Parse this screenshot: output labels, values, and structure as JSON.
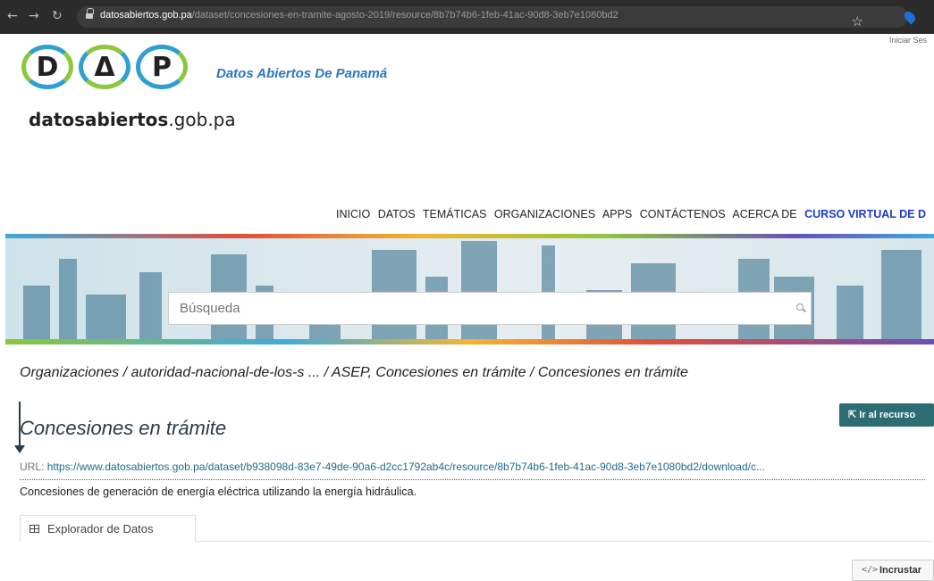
{
  "browser": {
    "url_host": "datosabiertos.gob.pa",
    "url_path": "/dataset/concesiones-en-tramite-agosto-2019/resource/8b7b74b6-1feb-41ac-90d8-3eb7e1080bd2",
    "back_icon": "back-arrow-icon",
    "forward_icon": "forward-arrow-icon",
    "reload_icon": "reload-icon",
    "star_icon": "bookmark-star-icon",
    "partial_text": "Iniciar Ses"
  },
  "logo": {
    "letters": [
      "D",
      "Δ",
      "P"
    ],
    "sub_bold": "datosabiertos",
    "sub_rest": ".gob.pa",
    "tagline": "Datos Abiertos De Panamá"
  },
  "nav": {
    "items": [
      "INICIO",
      "DATOS",
      "TEMÁTICAS",
      "ORGANIZACIONES",
      "APPS",
      "CONTÁCTENOS",
      "ACERCA DE"
    ],
    "accent": "CURSO VIRTUAL DE D"
  },
  "search": {
    "placeholder": "Búsqueda"
  },
  "breadcrumb": "Organizaciones / autoridad-nacional-de-los-s ... / ASEP, Concesiones en trámite / Concesiones en trámite",
  "resource": {
    "title": "Concesiones en trámite",
    "goto_button": "Ir al recurso",
    "url_label": "URL:",
    "url": "https://www.datosabiertos.gob.pa/dataset/b938098d-83e7-49de-90a6-d2cc1792ab4c/resource/8b7b74b6-1feb-41ac-90d8-3eb7e1080bd2/download/c...",
    "description": "Concesiones de generación de energía eléctrica utilizando la energía hidráulica."
  },
  "tabs": [
    {
      "label": "Explorador de Datos"
    }
  ],
  "embed_button": "Incrustar",
  "colors": {
    "accent_blue": "#2a76c6",
    "button_teal": "#2c6c73",
    "nav_accent": "#1a3bcc",
    "link": "#1e6a8e"
  }
}
